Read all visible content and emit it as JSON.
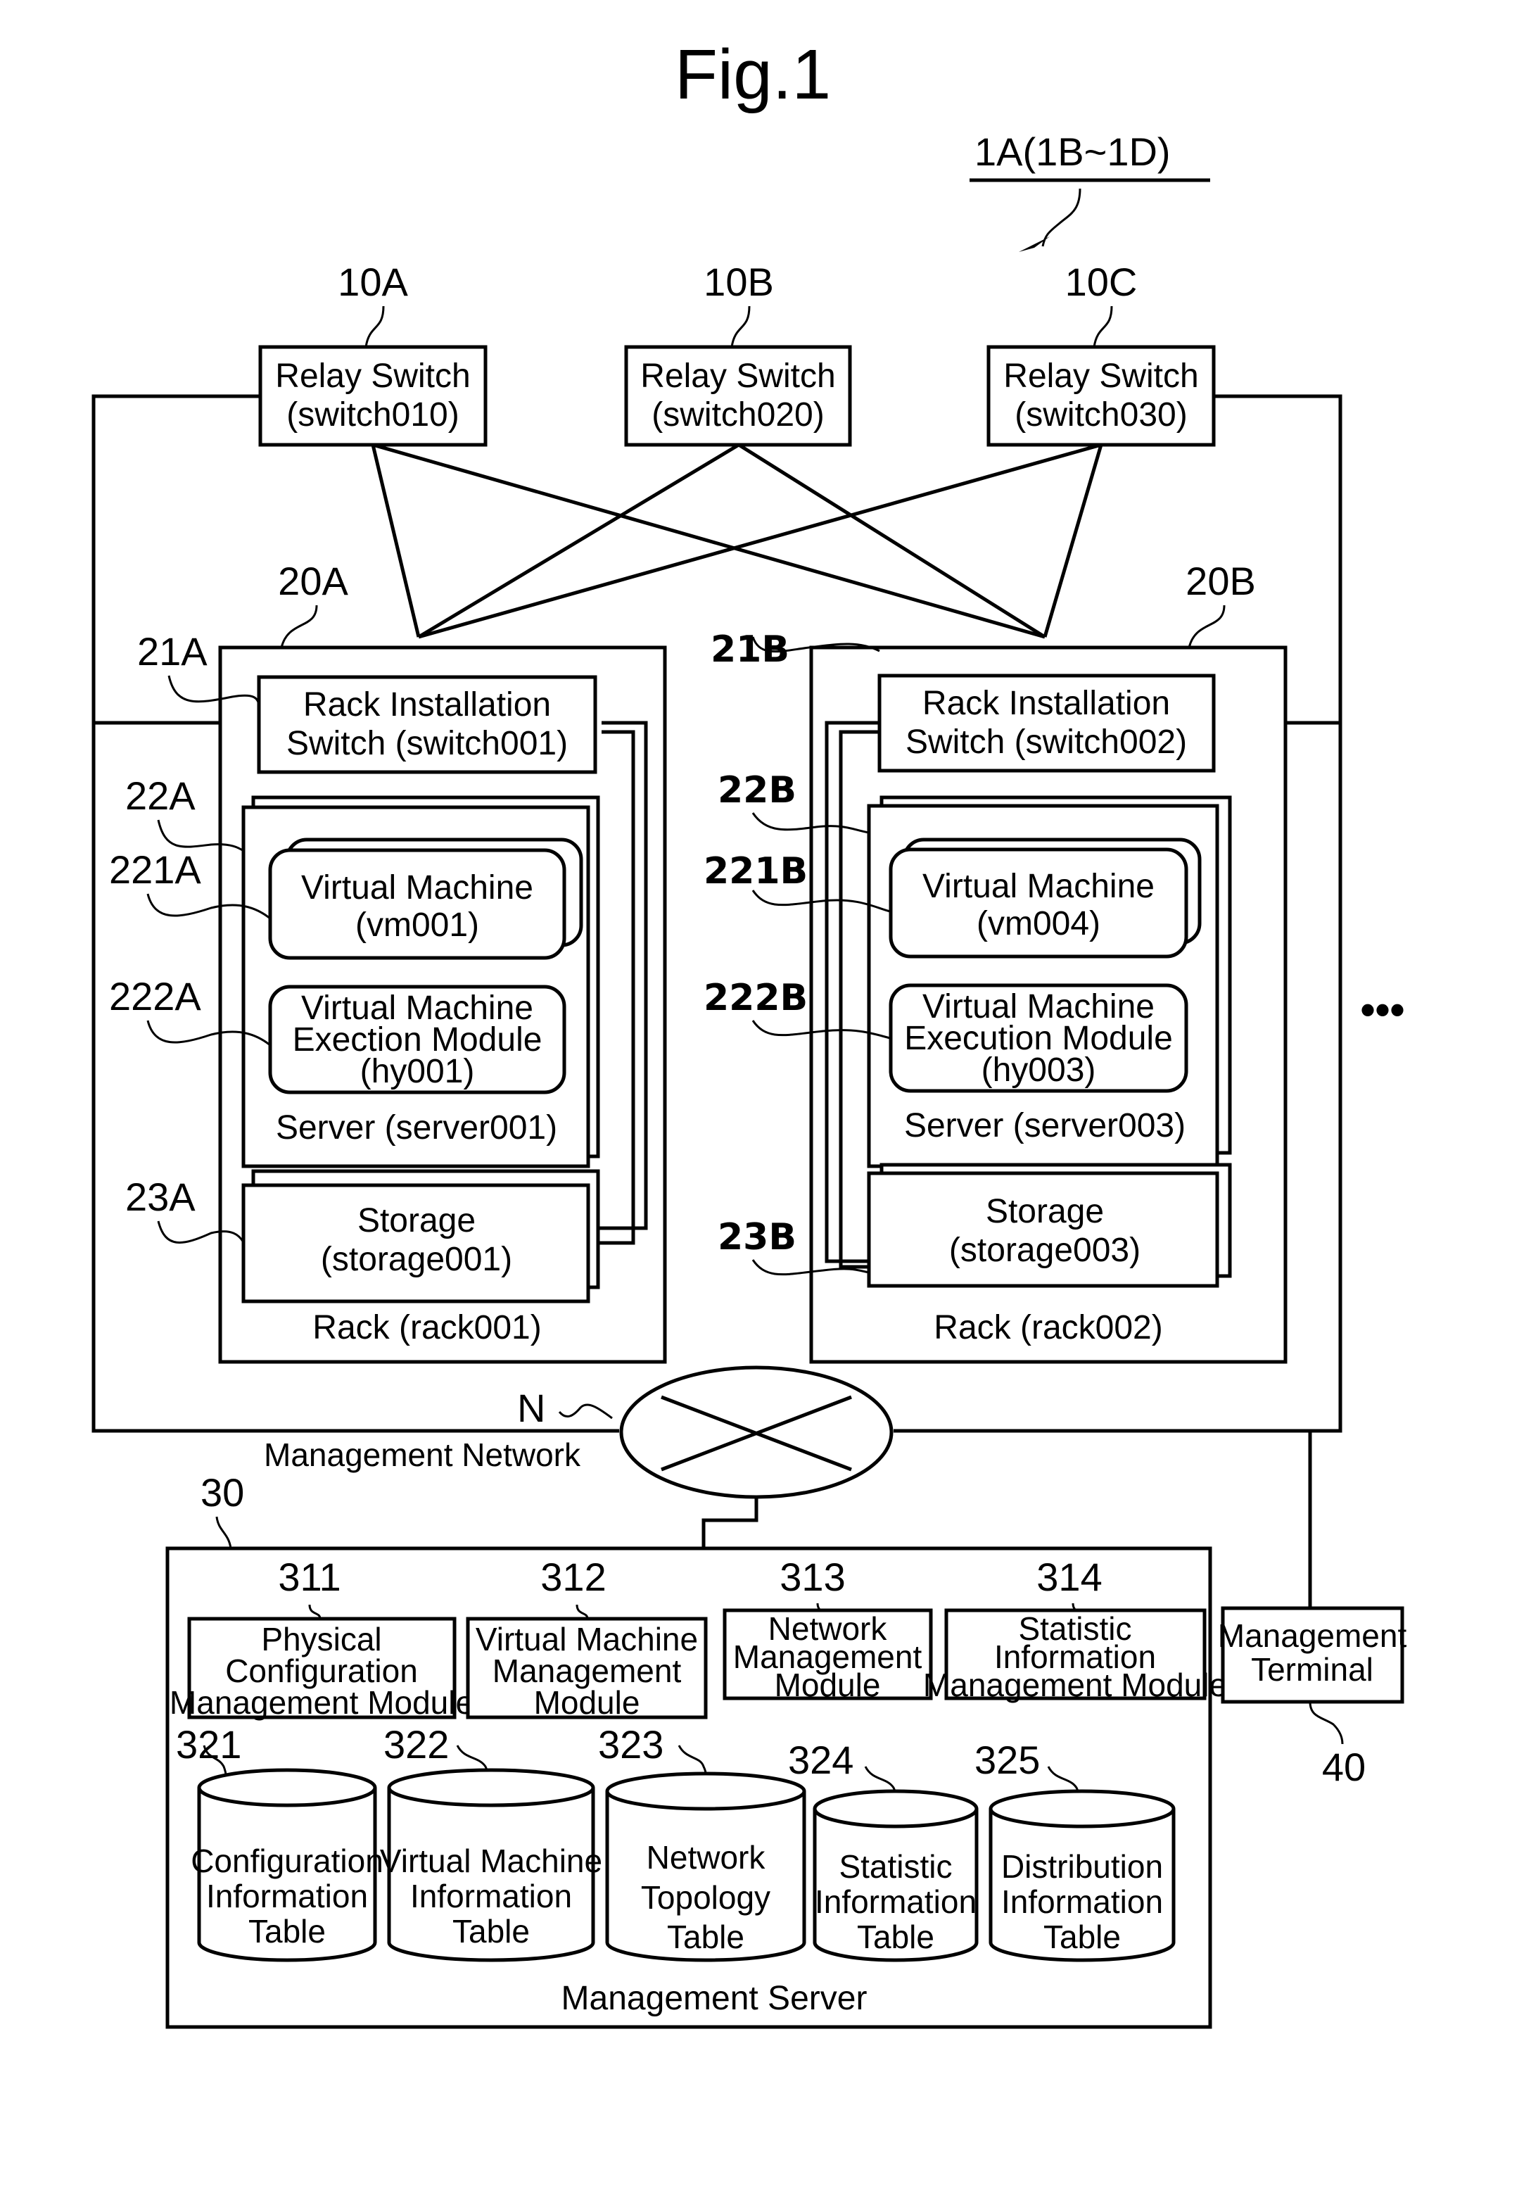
{
  "figure": {
    "title": "Fig.1",
    "system_ref": "1A(1B~1D)"
  },
  "relay_switches": [
    {
      "ref": "10A",
      "line1": "Relay Switch",
      "line2": "(switch010)"
    },
    {
      "ref": "10B",
      "line1": "Relay Switch",
      "line2": "(switch020)"
    },
    {
      "ref": "10C",
      "line1": "Relay Switch",
      "line2": "(switch030)"
    }
  ],
  "racks": [
    {
      "ref": "20A",
      "label": "Rack (rack001)",
      "switch": {
        "ref": "21A",
        "line1": "Rack Installation",
        "line2": "Switch (switch001)"
      },
      "server": {
        "ref": "22A",
        "label": "Server (server001)"
      },
      "vm": {
        "ref": "221A",
        "line1": "Virtual Machine",
        "line2": "(vm001)"
      },
      "hypervisor": {
        "ref": "222A",
        "line1": "Virtual Machine",
        "line2": "Exection Module",
        "line3": "(hy001)"
      },
      "storage": {
        "ref": "23A",
        "line1": "Storage",
        "line2": "(storage001)"
      }
    },
    {
      "ref": "20B",
      "label": "Rack (rack002)",
      "switch": {
        "ref": "21B",
        "line1": "Rack Installation",
        "line2": "Switch (switch002)"
      },
      "server": {
        "ref": "22B",
        "label": "Server (server003)"
      },
      "vm": {
        "ref": "221B",
        "line1": "Virtual Machine",
        "line2": "(vm004)"
      },
      "hypervisor": {
        "ref": "222B",
        "line1": "Virtual Machine",
        "line2": "Execution Module",
        "line3": "(hy003)"
      },
      "storage": {
        "ref": "23B",
        "line1": "Storage",
        "line2": "(storage003)"
      }
    }
  ],
  "ellipsis": "•••",
  "network": {
    "ref": "N",
    "label": "Management Network"
  },
  "management_server": {
    "ref": "30",
    "label": "Management Server",
    "modules": [
      {
        "ref": "311",
        "lines": [
          "Physical",
          "Configuration",
          "Management Module"
        ]
      },
      {
        "ref": "312",
        "lines": [
          "Virtual Machine",
          "Management",
          "Module"
        ]
      },
      {
        "ref": "313",
        "lines": [
          "Network",
          "Management",
          "Module"
        ]
      },
      {
        "ref": "314",
        "lines": [
          "Statistic",
          "Information",
          "Management Module"
        ]
      }
    ],
    "tables": [
      {
        "ref": "321",
        "lines": [
          "Configuration",
          "Information",
          "Table"
        ]
      },
      {
        "ref": "322",
        "lines": [
          "Virtual Machine",
          "Information",
          "Table"
        ]
      },
      {
        "ref": "323",
        "lines": [
          "Network",
          "Topology",
          "Table"
        ]
      },
      {
        "ref": "324",
        "lines": [
          "Statistic",
          "Information",
          "Table"
        ]
      },
      {
        "ref": "325",
        "lines": [
          "Distribution",
          "Information",
          "Table"
        ]
      }
    ]
  },
  "management_terminal": {
    "ref": "40",
    "lines": [
      "Management",
      "Terminal"
    ]
  }
}
